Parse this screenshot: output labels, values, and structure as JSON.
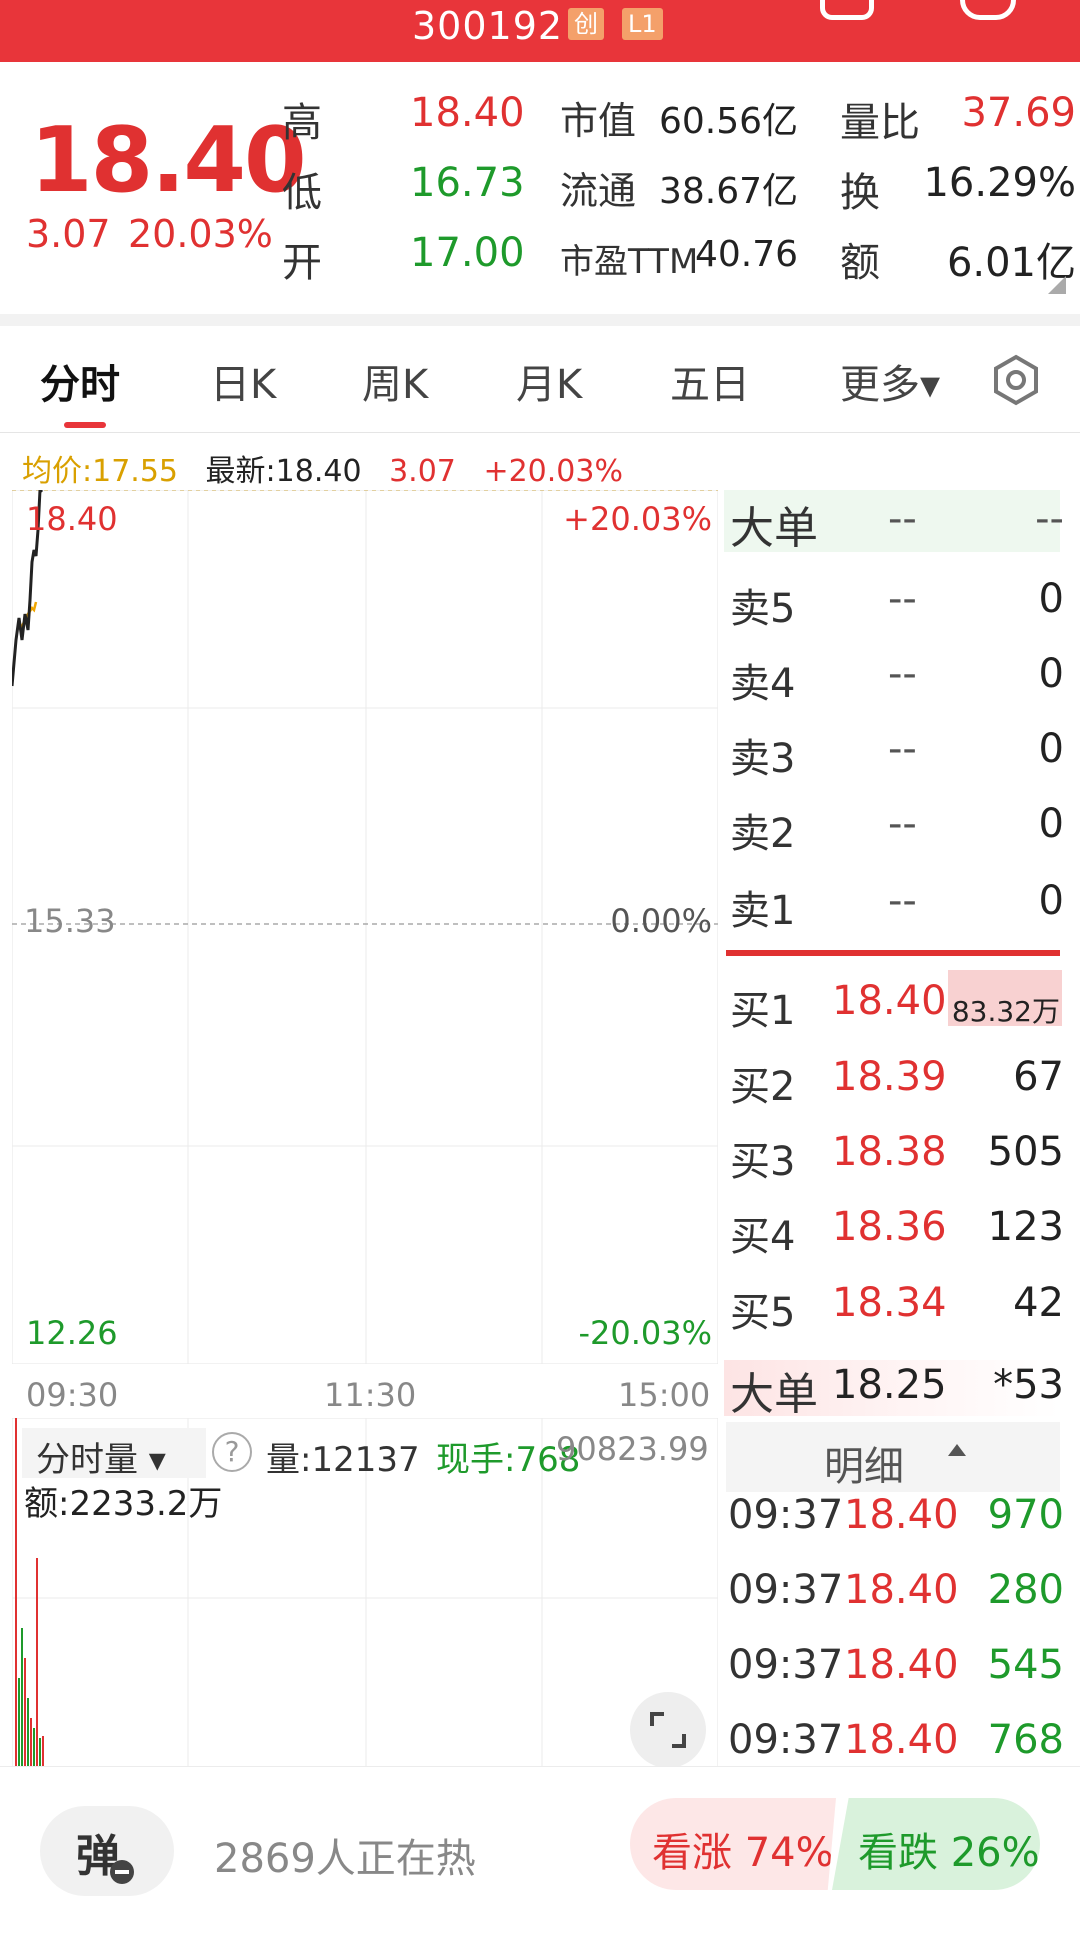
{
  "header": {
    "code": "300192",
    "board_tag": "创",
    "level_tag": "L1"
  },
  "quote": {
    "price": "18.40",
    "change": "3.07",
    "change_pct": "20.03%",
    "high_label": "高",
    "high": "18.40",
    "low_label": "低",
    "low": "16.73",
    "open_label": "开",
    "open": "17.00",
    "mcap_label": "市值",
    "mcap": "60.56亿",
    "float_label": "流通",
    "float": "38.67亿",
    "pe_label": "市盈TTM",
    "pe": "40.76",
    "vol_ratio_label": "量比",
    "vol_ratio": "37.69",
    "turnover_label": "换",
    "turnover": "16.29%",
    "amount_label": "额",
    "amount": "6.01亿"
  },
  "tabs": [
    {
      "label": "分时"
    },
    {
      "label": "日K"
    },
    {
      "label": "周K"
    },
    {
      "label": "月K"
    },
    {
      "label": "五日"
    },
    {
      "label": "更多▾"
    }
  ],
  "info": {
    "avg": "均价:17.55",
    "latest": "最新:18.40",
    "chg": "3.07",
    "pct": "+20.03%"
  },
  "chart": {
    "price_top": "18.40",
    "pct_top": "+20.03%",
    "price_mid": "15.33",
    "pct_mid": "0.00%",
    "price_bottom": "12.26",
    "pct_bottom": "-20.03%",
    "time_start": "09:30",
    "time_mid": "11:30",
    "time_end": "15:00",
    "vol_selector": "分时量 ▾",
    "vol_help": "?",
    "vol": "量:12137",
    "curhand": "现手:768",
    "vol_max": "90823.99",
    "vol_amount": "额:2233.2万",
    "colors": {
      "up": "#e03131",
      "down": "#1e9a2b",
      "line": "#222222",
      "avg": "#f0a500"
    }
  },
  "book": {
    "big_label": "大单",
    "big_v1": "--",
    "big_v2": "--",
    "asks": [
      {
        "label": "卖5",
        "price": "--",
        "vol": "0"
      },
      {
        "label": "卖4",
        "price": "--",
        "vol": "0"
      },
      {
        "label": "卖3",
        "price": "--",
        "vol": "0"
      },
      {
        "label": "卖2",
        "price": "--",
        "vol": "0"
      },
      {
        "label": "卖1",
        "price": "--",
        "vol": "0"
      }
    ],
    "bids": [
      {
        "label": "买1",
        "price": "18.40",
        "vol": "83.32万"
      },
      {
        "label": "买2",
        "price": "18.39",
        "vol": "67"
      },
      {
        "label": "买3",
        "price": "18.38",
        "vol": "505"
      },
      {
        "label": "买4",
        "price": "18.36",
        "vol": "123"
      },
      {
        "label": "买5",
        "price": "18.34",
        "vol": "42"
      }
    ],
    "big2_label": "大单",
    "big2_price": "18.25",
    "big2_vol": "*53",
    "detail_label": "明细",
    "details": [
      {
        "time": "09:37",
        "price": "18.40",
        "vol": "970"
      },
      {
        "time": "09:37",
        "price": "18.40",
        "vol": "280"
      },
      {
        "time": "09:37",
        "price": "18.40",
        "vol": "545"
      },
      {
        "time": "09:37",
        "price": "18.40",
        "vol": "768"
      }
    ]
  },
  "bottom": {
    "pop_label": "弹",
    "hot_text": "2869人正在热",
    "up_vote": "看涨 74%",
    "down_vote": "看跌 26%"
  }
}
